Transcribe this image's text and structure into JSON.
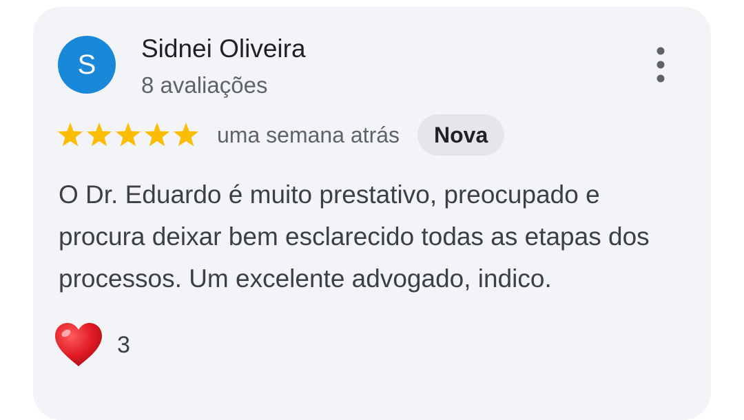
{
  "reviewer": {
    "avatar_letter": "S",
    "avatar_color": "#1a88d8",
    "name": "Sidnei Oliveira",
    "review_count": "8 avaliações"
  },
  "menu": {
    "icon": "more-vertical-icon"
  },
  "rating": {
    "stars": 5,
    "max_stars": 5,
    "star_color": "#fbbc04",
    "icon": "star-icon"
  },
  "date": "uma semana atrás",
  "badge": "Nova",
  "review_text": "O Dr. Eduardo é muito prestativo, preocupado e procura deixar bem esclarecido todas as etapas dos processos. Um excelente advogado, indico.",
  "reaction": {
    "icon": "heart-icon",
    "count": "3"
  }
}
